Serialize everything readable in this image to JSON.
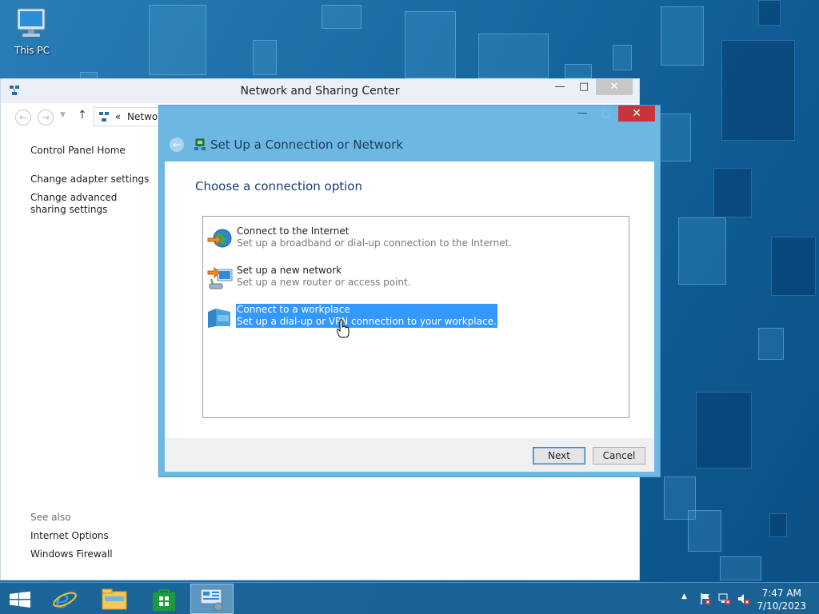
{
  "desktop": {
    "icon_label": "This PC"
  },
  "nsc_window": {
    "title": "Network and Sharing Center",
    "address_text": "Network",
    "address_prefix": "«",
    "sidebar": {
      "home": "Control Panel Home",
      "links": [
        "Change adapter settings",
        "Change advanced sharing settings"
      ]
    },
    "see_also": {
      "heading": "See also",
      "links": [
        "Internet Options",
        "Windows Firewall"
      ]
    }
  },
  "dialog": {
    "title": "Set Up a Connection or Network",
    "heading": "Choose a connection option",
    "options": [
      {
        "title": "Connect to the Internet",
        "desc": "Set up a broadband or dial-up connection to the Internet.",
        "icon": "globe-icon"
      },
      {
        "title": "Set up a new network",
        "desc": "Set up a new router or access point.",
        "icon": "router-icon"
      },
      {
        "title": "Connect to a workplace",
        "desc": "Set up a dial-up or VPN connection to your workplace.",
        "icon": "workplace-icon",
        "selected": true
      }
    ],
    "next_label": "Next",
    "cancel_label": "Cancel"
  },
  "taskbar": {
    "time": "7:47 AM",
    "date": "7/10/2023",
    "items": [
      "start-icon",
      "ie-icon",
      "file-explorer-icon",
      "store-icon",
      "control-panel-icon"
    ]
  },
  "colors": {
    "dialog_frame": "#6cb8e3",
    "selection": "#3399ff",
    "close_red": "#c8343b",
    "heading_blue": "#1a3c73"
  }
}
